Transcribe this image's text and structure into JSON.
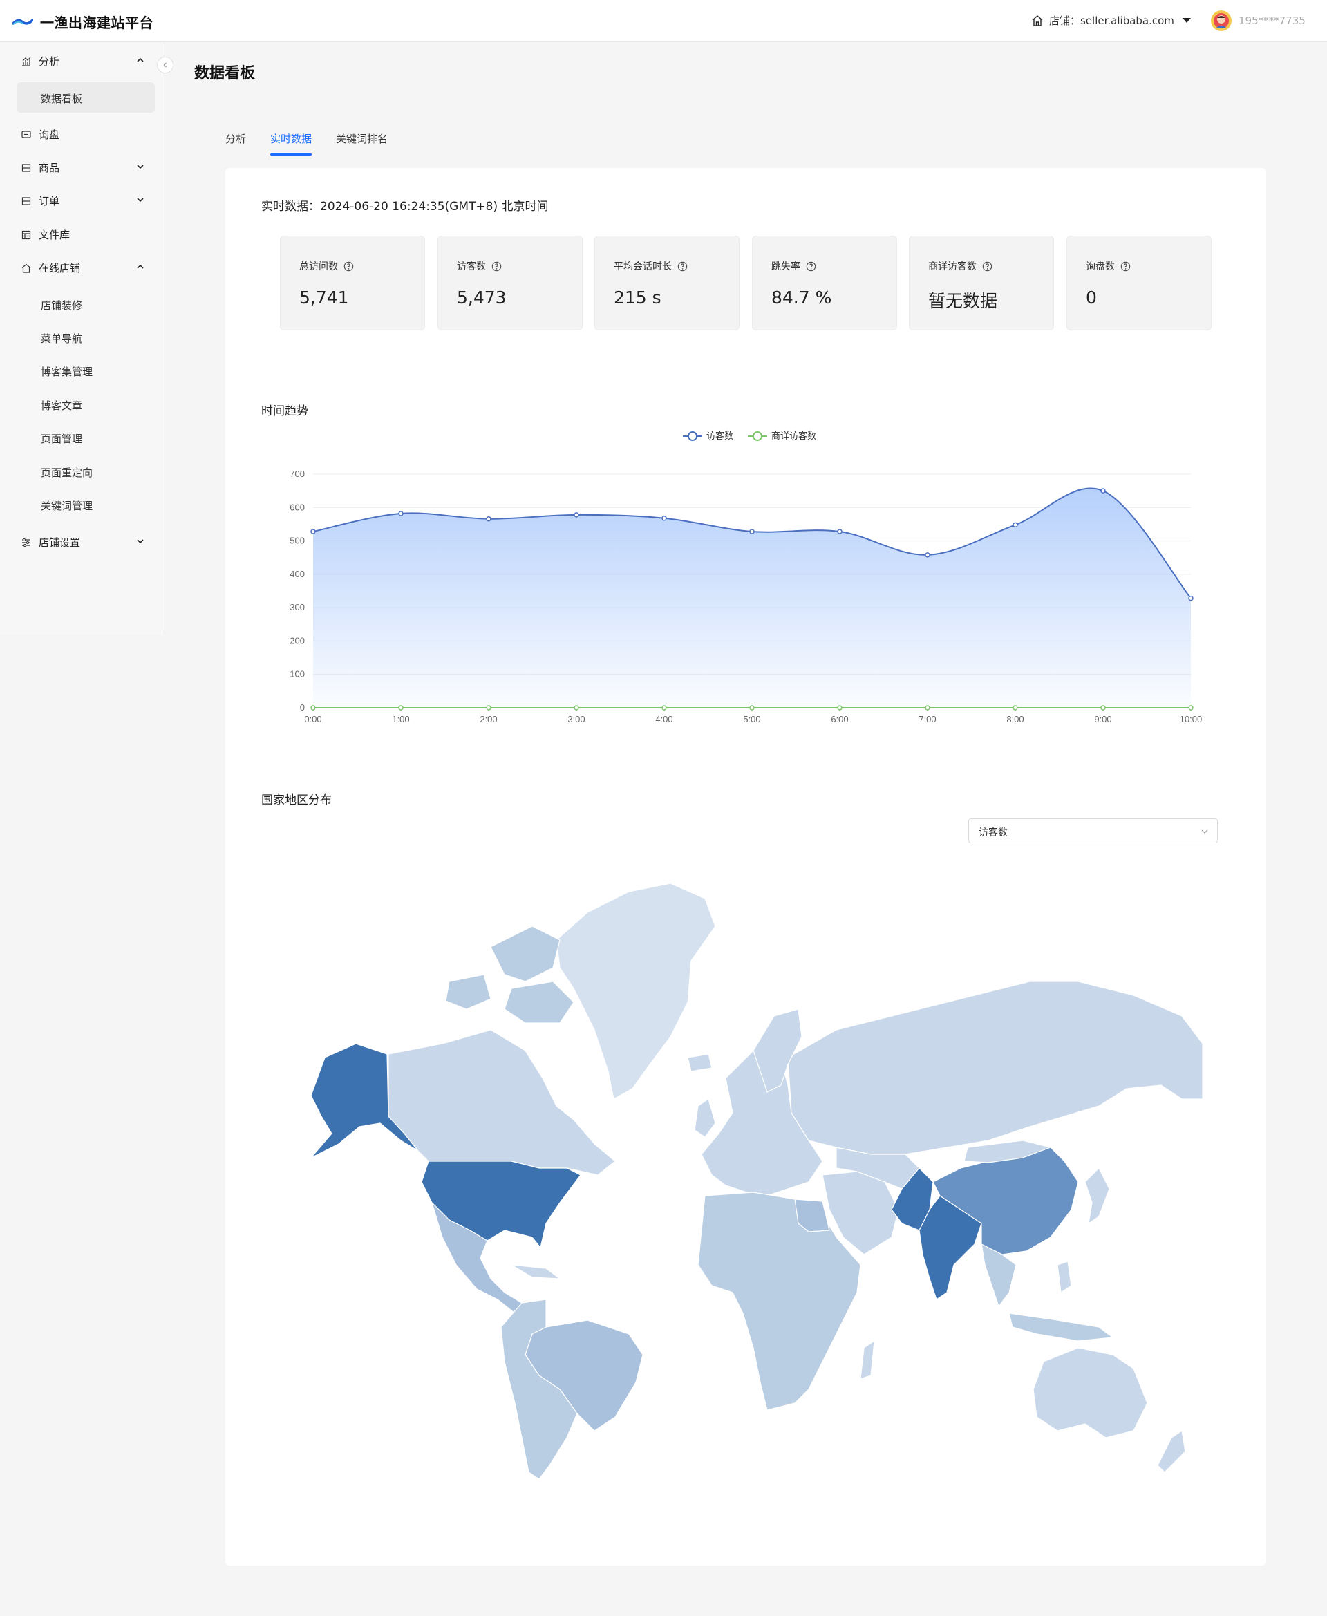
{
  "header": {
    "app_title": "一渔出海建站平台",
    "shop_label": "店铺：seller.alibaba.com",
    "user_phone": "195****7735"
  },
  "sidebar": {
    "groups": [
      {
        "label": "分析",
        "icon": "chart-icon",
        "expanded": true,
        "children": [
          "数据看板"
        ]
      },
      {
        "label": "询盘",
        "icon": "message-icon"
      },
      {
        "label": "商品",
        "icon": "box-icon",
        "expanded": false
      },
      {
        "label": "订单",
        "icon": "order-icon",
        "expanded": false
      },
      {
        "label": "文件库",
        "icon": "folder-icon"
      },
      {
        "label": "在线店铺",
        "icon": "home-icon",
        "expanded": true,
        "children": [
          "店铺装修",
          "菜单导航",
          "博客集管理",
          "博客文章",
          "页面管理",
          "页面重定向",
          "关键词管理"
        ]
      },
      {
        "label": "店铺设置",
        "icon": "settings-icon",
        "expanded": false
      }
    ],
    "active_item": "数据看板"
  },
  "page": {
    "title": "数据看板",
    "tabs": [
      {
        "label": "分析",
        "active": false
      },
      {
        "label": "实时数据",
        "active": true
      },
      {
        "label": "关键词排名",
        "active": false
      }
    ],
    "realtime_label": "实时数据：2024-06-20 16:24:35(GMT+8) 北京时间"
  },
  "kpis": [
    {
      "label": "总访问数",
      "value": "5,741"
    },
    {
      "label": "访客数",
      "value": "5,473"
    },
    {
      "label": "平均会话时长",
      "value": "215 s"
    },
    {
      "label": "跳失率",
      "value": "84.7 %"
    },
    {
      "label": "商详访客数",
      "value": "暂无数据"
    },
    {
      "label": "询盘数",
      "value": "0"
    }
  ],
  "trend": {
    "title": "时间趋势"
  },
  "chart_data": {
    "type": "line",
    "categories": [
      "0:00",
      "1:00",
      "2:00",
      "3:00",
      "4:00",
      "5:00",
      "6:00",
      "7:00",
      "8:00",
      "9:00",
      "10:00"
    ],
    "series": [
      {
        "name": "访客数",
        "values": [
          528,
          582,
          566,
          578,
          568,
          528,
          528,
          458,
          548,
          650,
          328
        ],
        "color": "#4a6fbf",
        "area": true
      },
      {
        "name": "商详访客数",
        "values": [
          0,
          0,
          0,
          0,
          0,
          0,
          0,
          0,
          0,
          0,
          0
        ],
        "color": "#7cc46a"
      }
    ],
    "ylim": [
      0,
      700
    ],
    "yticks": [
      0,
      100,
      200,
      300,
      400,
      500,
      600,
      700
    ],
    "legend_position": "top-center",
    "grid": true,
    "smooth": true
  },
  "geo": {
    "title": "国家地区分布",
    "metric_select": "访客数",
    "colors": {
      "high": "#3d72b0",
      "mid": "#6891c4",
      "low_mid": "#a9c1dd",
      "low": "#c8d7e9",
      "lowest": "#d5e1ef"
    }
  },
  "colors": {
    "accent": "#1a6cff"
  }
}
